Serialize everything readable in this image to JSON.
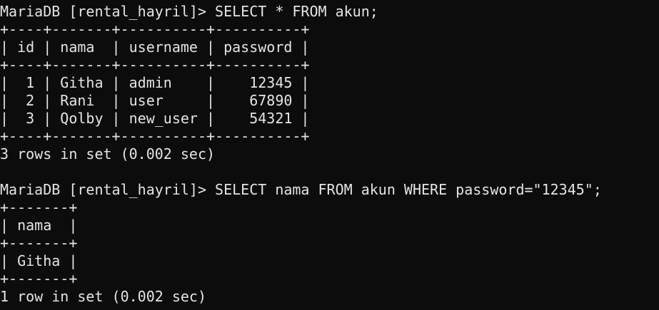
{
  "terminal": {
    "lines": [
      "MariaDB [rental_hayril]> SELECT * FROM akun;",
      "+----+-------+----------+----------+",
      "| id | nama  | username | password |",
      "+----+-------+----------+----------+",
      "|  1 | Githa | admin    |    12345 |",
      "|  2 | Rani  | user     |    67890 |",
      "|  3 | Qolby | new_user |    54321 |",
      "+----+-------+----------+----------+",
      "3 rows in set (0.002 sec)",
      "",
      "MariaDB [rental_hayril]> SELECT nama FROM akun WHERE password=\"12345\";",
      "+-------+",
      "| nama  |",
      "+-------+",
      "| Githa |",
      "+-------+",
      "1 row in set (0.002 sec)"
    ]
  }
}
